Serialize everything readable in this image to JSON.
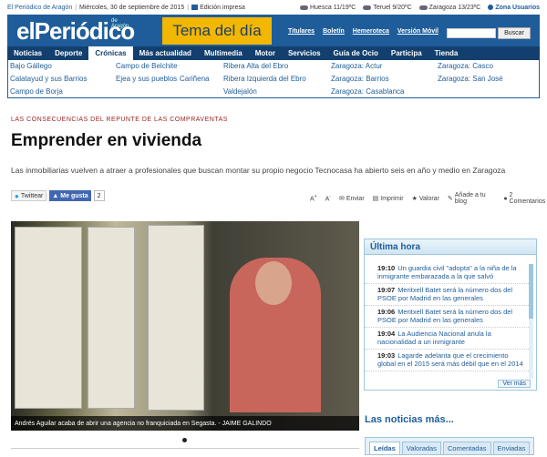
{
  "topbar": {
    "site": "El Periódico de Aragón",
    "date": "Miércoles, 30 de septiembre de 2015",
    "edition": "Edición impresa",
    "weather": [
      {
        "city": "Huesca",
        "temps": "11/19ºC"
      },
      {
        "city": "Teruel",
        "temps": "9/20ºC"
      },
      {
        "city": "Zaragoza",
        "temps": "13/23ºC"
      }
    ],
    "user_zone": "Zona Usuarios"
  },
  "masthead": {
    "logo": "elPeriódico",
    "logo_sub": "de Aragón",
    "tema": "Tema del día",
    "links": [
      "Titulares",
      "Boletín",
      "Hemeroteca",
      "Versión Móvil"
    ],
    "search_placeholder": "",
    "search_button": "Buscar",
    "color_primary": "#1f5d9a",
    "color_tema": "#f2b700"
  },
  "nav": {
    "items": [
      "Noticias",
      "Deporte",
      "Crónicas",
      "Más actualidad",
      "Multimedia",
      "Motor",
      "Servicios",
      "Guía de Ocio",
      "Participa",
      "Tienda"
    ],
    "active": "Crónicas"
  },
  "subnav": {
    "items": [
      "Bajo Gállego",
      "Campo de Belchite",
      "Ribera Alta del Ebro",
      "Zaragoza: Actur",
      "Zaragoza: Casco",
      "Calatayud y sus Barrios",
      "Ejea y sus pueblos",
      "Cariñena",
      "Ribera Izquierda del Ebro",
      "Zaragoza: Barrios",
      "Zaragoza: San José",
      "Campo de Borja",
      "Valdejalón",
      "Zaragoza: Casablanca"
    ]
  },
  "article": {
    "kicker": "LAS CONSECUENCIAS DEL REPUNTE DE LAS COMPRAVENTAS",
    "headline": "Emprender en vivienda",
    "lead": "Las inmobiliarias vuelven a atraer a profesionales que buscan montar su propio negocio Tecnocasa ha abierto seis en año y medio en Zaragoza",
    "photo_caption": "Andrés Aguilar acaba de abrir una agencia no franquiciada en Segasta. - JAIME GALINDO"
  },
  "social": {
    "twitter": "Twittear",
    "facebook": "Me gusta",
    "facebook_count": "2"
  },
  "tools": {
    "items": [
      "Enviar",
      "Imprimir",
      "Valorar",
      "Añade a tu blog",
      "2 Comentarios"
    ]
  },
  "ultima_hora": {
    "title": "Última hora",
    "items": [
      {
        "time": "19:10",
        "text": "Un guardia civil \"adopta\" a la niña de la inmigrante embarazada a la que salvó"
      },
      {
        "time": "19:07",
        "text": "Meritxell Batet será la número dos del PSOE por Madrid en las generales"
      },
      {
        "time": "19:06",
        "text": "Meritxell Batet será la número dos del PSOE por Madrid en las generales"
      },
      {
        "time": "19:04",
        "text": "La Audiencia Nacional anula la nacionalidad a un inmigrante"
      },
      {
        "time": "19:03",
        "text": "Lagarde adelanta que el crecimiento global en el 2015 será más débil que en el 2014"
      }
    ],
    "more": "Ver más"
  },
  "noticias_mas": {
    "title": "Las noticias más...",
    "tabs": [
      "Leídas",
      "Valoradas",
      "Comentadas",
      "Enviadas"
    ],
    "active": "Leídas"
  }
}
